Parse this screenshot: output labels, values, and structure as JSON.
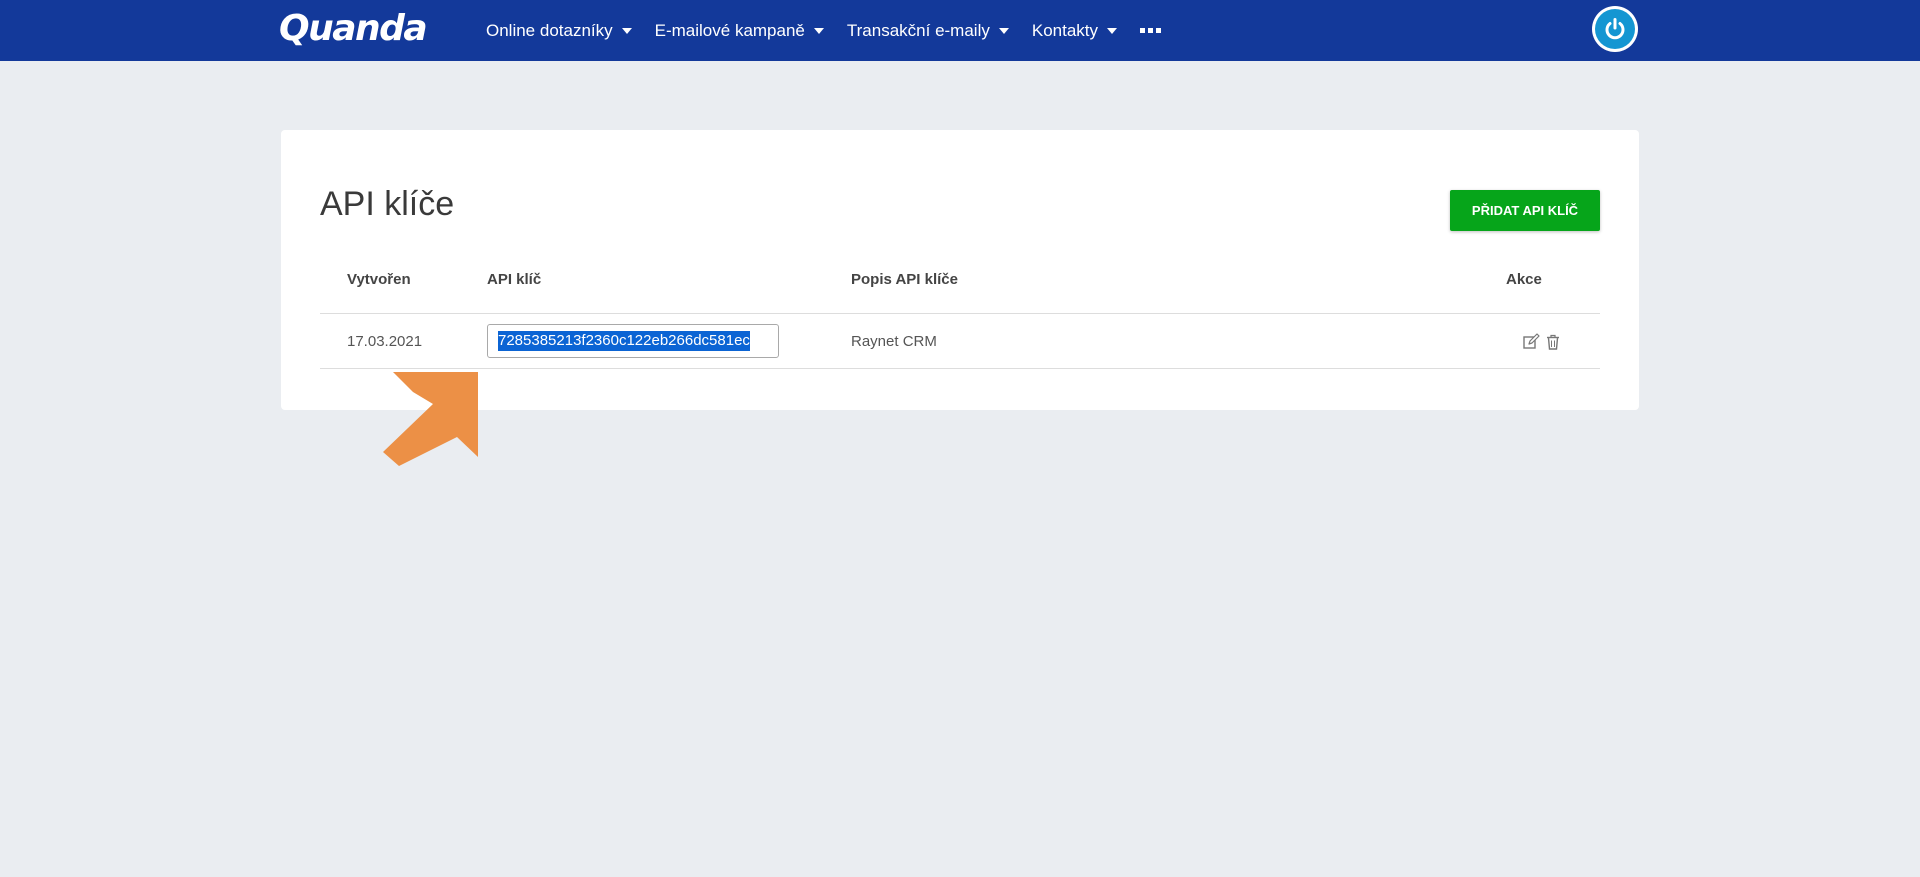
{
  "header": {
    "logo_text": "Quanda",
    "nav": [
      {
        "label": "Online dotazníky"
      },
      {
        "label": "E-mailové kampaně"
      },
      {
        "label": "Transakční e-maily"
      },
      {
        "label": "Kontakty"
      }
    ],
    "more_icon": "more-dots-icon",
    "power_icon": "power-icon"
  },
  "page": {
    "title": "API klíče",
    "add_button_label": "PŘIDAT API KLÍČ"
  },
  "table": {
    "columns": [
      "Vytvořen",
      "API klíč",
      "Popis API klíče",
      "Akce"
    ],
    "rows": [
      {
        "created": "17.03.2021",
        "api_key": "7285385213f2360c122eb266dc581ec",
        "description": "Raynet CRM",
        "actions": [
          "edit-icon",
          "delete-icon"
        ]
      }
    ]
  },
  "colors": {
    "header_bg": "#13399a",
    "page_bg": "#eaedf1",
    "add_button": "#06a51a",
    "selection": "#0b64d4",
    "arrow": "#ec9046"
  }
}
